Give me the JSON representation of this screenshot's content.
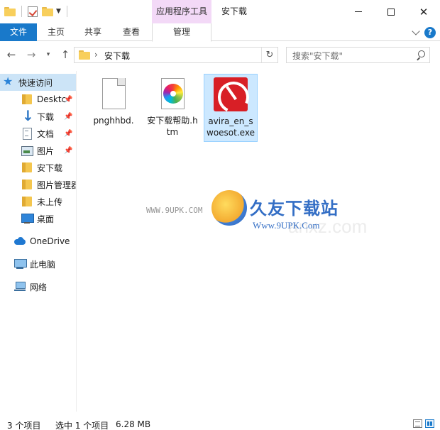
{
  "window": {
    "title": "安下载",
    "contextual_tab_group": "应用程序工具",
    "min_label": "─",
    "max_label": "□",
    "close_label": "✕"
  },
  "ribbon": {
    "tabs": [
      {
        "label": "文件"
      },
      {
        "label": "主页"
      },
      {
        "label": "共享"
      },
      {
        "label": "查看"
      },
      {
        "label": "管理"
      }
    ],
    "help_label": "?"
  },
  "nav": {
    "back": "←",
    "forward": "→",
    "recent": "▾",
    "up": "↑",
    "address_separator": "›",
    "address": "安下载",
    "refresh": "↻",
    "search_placeholder": "搜索\"安下载\""
  },
  "sidebar": {
    "items": [
      {
        "label": "快速访问",
        "icon": "star-icon",
        "pinned": false
      },
      {
        "label": "Desktc",
        "icon": "folder-icon",
        "pinned": true
      },
      {
        "label": "下载",
        "icon": "download-icon",
        "pinned": true
      },
      {
        "label": "文档",
        "icon": "document-icon",
        "pinned": true
      },
      {
        "label": "图片",
        "icon": "pictures-icon",
        "pinned": true
      },
      {
        "label": "安下载",
        "icon": "folder-icon",
        "pinned": false
      },
      {
        "label": "图片管理器",
        "icon": "folder-icon",
        "pinned": false
      },
      {
        "label": "未上传",
        "icon": "folder-icon",
        "pinned": false
      },
      {
        "label": "桌面",
        "icon": "desktop-icon",
        "pinned": false
      },
      {
        "label": "OneDrive",
        "icon": "onedrive-icon",
        "pinned": false
      },
      {
        "label": "此电脑",
        "icon": "this-pc-icon",
        "pinned": false
      },
      {
        "label": "网络",
        "icon": "network-icon",
        "pinned": false
      }
    ],
    "pin_glyph": "📌"
  },
  "files": [
    {
      "name": "pnghhbd.",
      "icon": "generic-file-icon",
      "selected": false
    },
    {
      "name": "安下载帮助.htm",
      "icon": "htm-file-icon",
      "selected": false
    },
    {
      "name": "avira_en_swoesot.exe",
      "icon": "avira-exe-icon",
      "selected": true
    }
  ],
  "watermark": {
    "small": "WWW.9UPK.COM",
    "big": "久友下载站",
    "url": "Www.9UPK.Com",
    "ghost": "anxz.com"
  },
  "status": {
    "item_count": "3 个项目",
    "selection": "选中 1 个项目",
    "size": "6.28 MB"
  },
  "colors": {
    "accent": "#1979ca",
    "selection": "#cce8ff",
    "contextual_tab": "#f3d9f7"
  }
}
